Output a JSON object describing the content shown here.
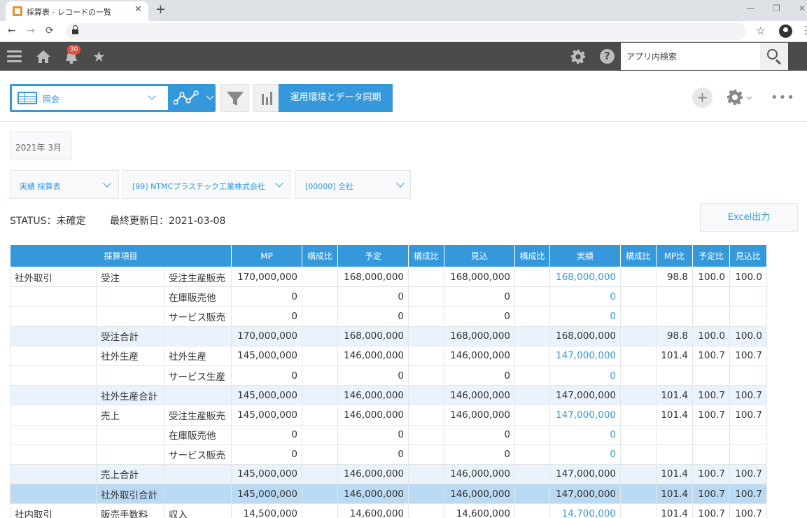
{
  "browser": {
    "tab_title": "採算表 - レコードの一覧",
    "tab_close": "✕",
    "new_tab": "+",
    "win_min": "—",
    "win_max": "❐",
    "win_close": "✕"
  },
  "header": {
    "notification_count": "30",
    "help_label": "?",
    "search_placeholder": "アプリ内検索"
  },
  "toolbar": {
    "view_label": "照会",
    "sync_button": "運用環境とデータ同期",
    "add_label": "+",
    "more_label": "•••"
  },
  "filters": {
    "month": "2021年 3月",
    "report_type": "実績 採算表",
    "company": "[99] NTMCプラスチック工業株式会社",
    "unit": "[00000] 全社"
  },
  "status": {
    "status_text": "STATUS：未確定",
    "updated_text": "最終更新日：2021-03-08"
  },
  "excel_button": "Excel出力",
  "table": {
    "headers": [
      "採算項目",
      "MP",
      "構成比",
      "予定",
      "構成比",
      "見込",
      "構成比",
      "実績",
      "構成比",
      "MP比",
      "予定比",
      "見込比"
    ],
    "rows": [
      {
        "type": "normal",
        "c1": "社外取引",
        "c2": "受注",
        "c3": "受注生産販売",
        "mp": "170,000,000",
        "mp_r": "",
        "plan": "168,000,000",
        "plan_r": "",
        "fc": "168,000,000",
        "fc_r": "",
        "act": "168,000,000",
        "act_link": true,
        "act_r": "",
        "mp_ratio": "98.8",
        "plan_ratio": "100.0",
        "fc_ratio": "100.0"
      },
      {
        "type": "normal",
        "c1": "",
        "c2": "",
        "c3": "在庫販売他",
        "mp": "0",
        "mp_r": "",
        "plan": "0",
        "plan_r": "",
        "fc": "0",
        "fc_r": "",
        "act": "0",
        "act_link": true,
        "act_r": "",
        "mp_ratio": "",
        "plan_ratio": "",
        "fc_ratio": ""
      },
      {
        "type": "normal",
        "c1": "",
        "c2": "",
        "c3": "サービス販売",
        "mp": "0",
        "mp_r": "",
        "plan": "0",
        "plan_r": "",
        "fc": "0",
        "fc_r": "",
        "act": "0",
        "act_link": true,
        "act_r": "",
        "mp_ratio": "",
        "plan_ratio": "",
        "fc_ratio": ""
      },
      {
        "type": "subtotal",
        "c1": "",
        "c2": "受注合計",
        "c3": "",
        "mp": "170,000,000",
        "mp_r": "",
        "plan": "168,000,000",
        "plan_r": "",
        "fc": "168,000,000",
        "fc_r": "",
        "act": "168,000,000",
        "act_link": false,
        "act_r": "",
        "mp_ratio": "98.8",
        "plan_ratio": "100.0",
        "fc_ratio": "100.0"
      },
      {
        "type": "normal",
        "c1": "",
        "c2": "社外生産",
        "c3": "社外生産",
        "mp": "145,000,000",
        "mp_r": "",
        "plan": "146,000,000",
        "plan_r": "",
        "fc": "146,000,000",
        "fc_r": "",
        "act": "147,000,000",
        "act_link": true,
        "act_r": "",
        "mp_ratio": "101.4",
        "plan_ratio": "100.7",
        "fc_ratio": "100.7"
      },
      {
        "type": "normal",
        "c1": "",
        "c2": "",
        "c3": "サービス生産",
        "mp": "0",
        "mp_r": "",
        "plan": "0",
        "plan_r": "",
        "fc": "0",
        "fc_r": "",
        "act": "0",
        "act_link": true,
        "act_r": "",
        "mp_ratio": "",
        "plan_ratio": "",
        "fc_ratio": ""
      },
      {
        "type": "subtotal",
        "c1": "",
        "c2": "社外生産合計",
        "c3": "",
        "mp": "145,000,000",
        "mp_r": "",
        "plan": "146,000,000",
        "plan_r": "",
        "fc": "146,000,000",
        "fc_r": "",
        "act": "147,000,000",
        "act_link": false,
        "act_r": "",
        "mp_ratio": "101.4",
        "plan_ratio": "100.7",
        "fc_ratio": "100.7"
      },
      {
        "type": "normal",
        "c1": "",
        "c2": "売上",
        "c3": "受注生産販売",
        "mp": "145,000,000",
        "mp_r": "",
        "plan": "146,000,000",
        "plan_r": "",
        "fc": "146,000,000",
        "fc_r": "",
        "act": "147,000,000",
        "act_link": true,
        "act_r": "",
        "mp_ratio": "101.4",
        "plan_ratio": "100.7",
        "fc_ratio": "100.7"
      },
      {
        "type": "normal",
        "c1": "",
        "c2": "",
        "c3": "在庫販売他",
        "mp": "0",
        "mp_r": "",
        "plan": "0",
        "plan_r": "",
        "fc": "0",
        "fc_r": "",
        "act": "0",
        "act_link": true,
        "act_r": "",
        "mp_ratio": "",
        "plan_ratio": "",
        "fc_ratio": ""
      },
      {
        "type": "normal",
        "c1": "",
        "c2": "",
        "c3": "サービス販売",
        "mp": "0",
        "mp_r": "",
        "plan": "0",
        "plan_r": "",
        "fc": "0",
        "fc_r": "",
        "act": "0",
        "act_link": true,
        "act_r": "",
        "mp_ratio": "",
        "plan_ratio": "",
        "fc_ratio": ""
      },
      {
        "type": "subtotal",
        "c1": "",
        "c2": "売上合計",
        "c3": "",
        "mp": "145,000,000",
        "mp_r": "",
        "plan": "146,000,000",
        "plan_r": "",
        "fc": "146,000,000",
        "fc_r": "",
        "act": "147,000,000",
        "act_link": false,
        "act_r": "",
        "mp_ratio": "101.4",
        "plan_ratio": "100.7",
        "fc_ratio": "100.7"
      },
      {
        "type": "total",
        "c1": "",
        "c2": "社外取引合計",
        "c3": "",
        "mp": "145,000,000",
        "mp_r": "",
        "plan": "146,000,000",
        "plan_r": "",
        "fc": "146,000,000",
        "fc_r": "",
        "act": "147,000,000",
        "act_link": false,
        "act_r": "",
        "mp_ratio": "101.4",
        "plan_ratio": "100.7",
        "fc_ratio": "100.7"
      },
      {
        "type": "normal",
        "c1": "社内取引",
        "c2": "販売手数料",
        "c3": "収入",
        "mp": "14,500,000",
        "mp_r": "",
        "plan": "14,600,000",
        "plan_r": "",
        "fc": "14,600,000",
        "fc_r": "",
        "act": "14,700,000",
        "act_link": true,
        "act_r": "",
        "mp_ratio": "101.4",
        "plan_ratio": "100.7",
        "fc_ratio": "100.7"
      }
    ]
  },
  "colors": {
    "accent": "#3498db",
    "header_bar": "#4b4b4b",
    "subtotal_row": "#eaf3fb",
    "total_row": "#bad9f3",
    "badge": "#e74c3c"
  },
  "icons": [
    "hamburger-icon",
    "home-icon",
    "bell-icon",
    "star-icon",
    "gear-icon",
    "help-icon",
    "search-icon",
    "table-view-icon",
    "graph-icon",
    "filter-icon",
    "bar-chart-icon",
    "plus-icon",
    "more-icon",
    "lock-icon"
  ]
}
